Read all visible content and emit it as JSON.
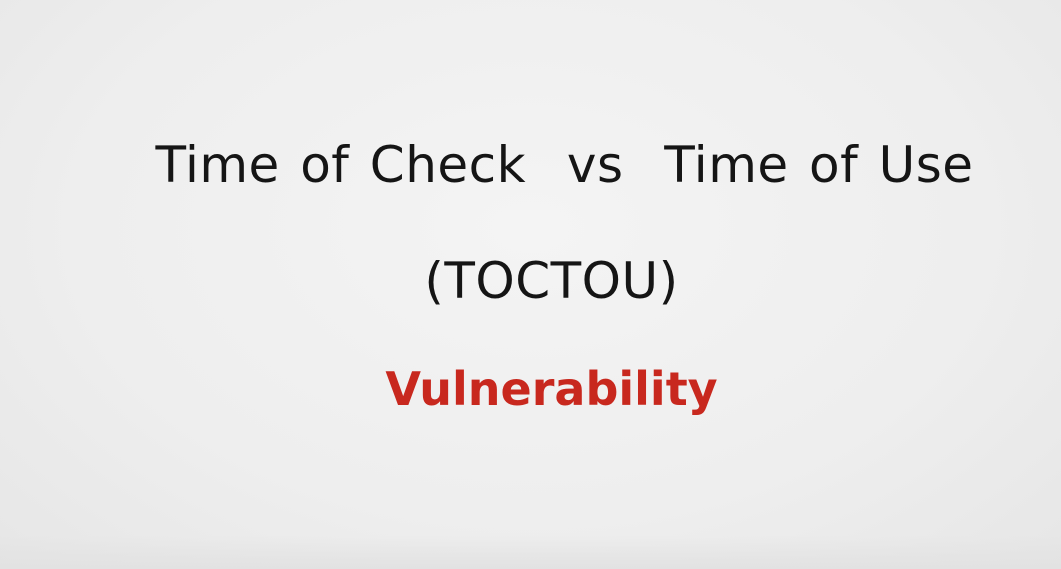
{
  "slide": {
    "title": "Time of Check  vs  Time of Use",
    "subtitle": "(TOCTOU)",
    "emphasis": "Vulnerability",
    "colors": {
      "background": "#efefef",
      "text": "#151515",
      "emphasis": "#c8281e"
    }
  }
}
